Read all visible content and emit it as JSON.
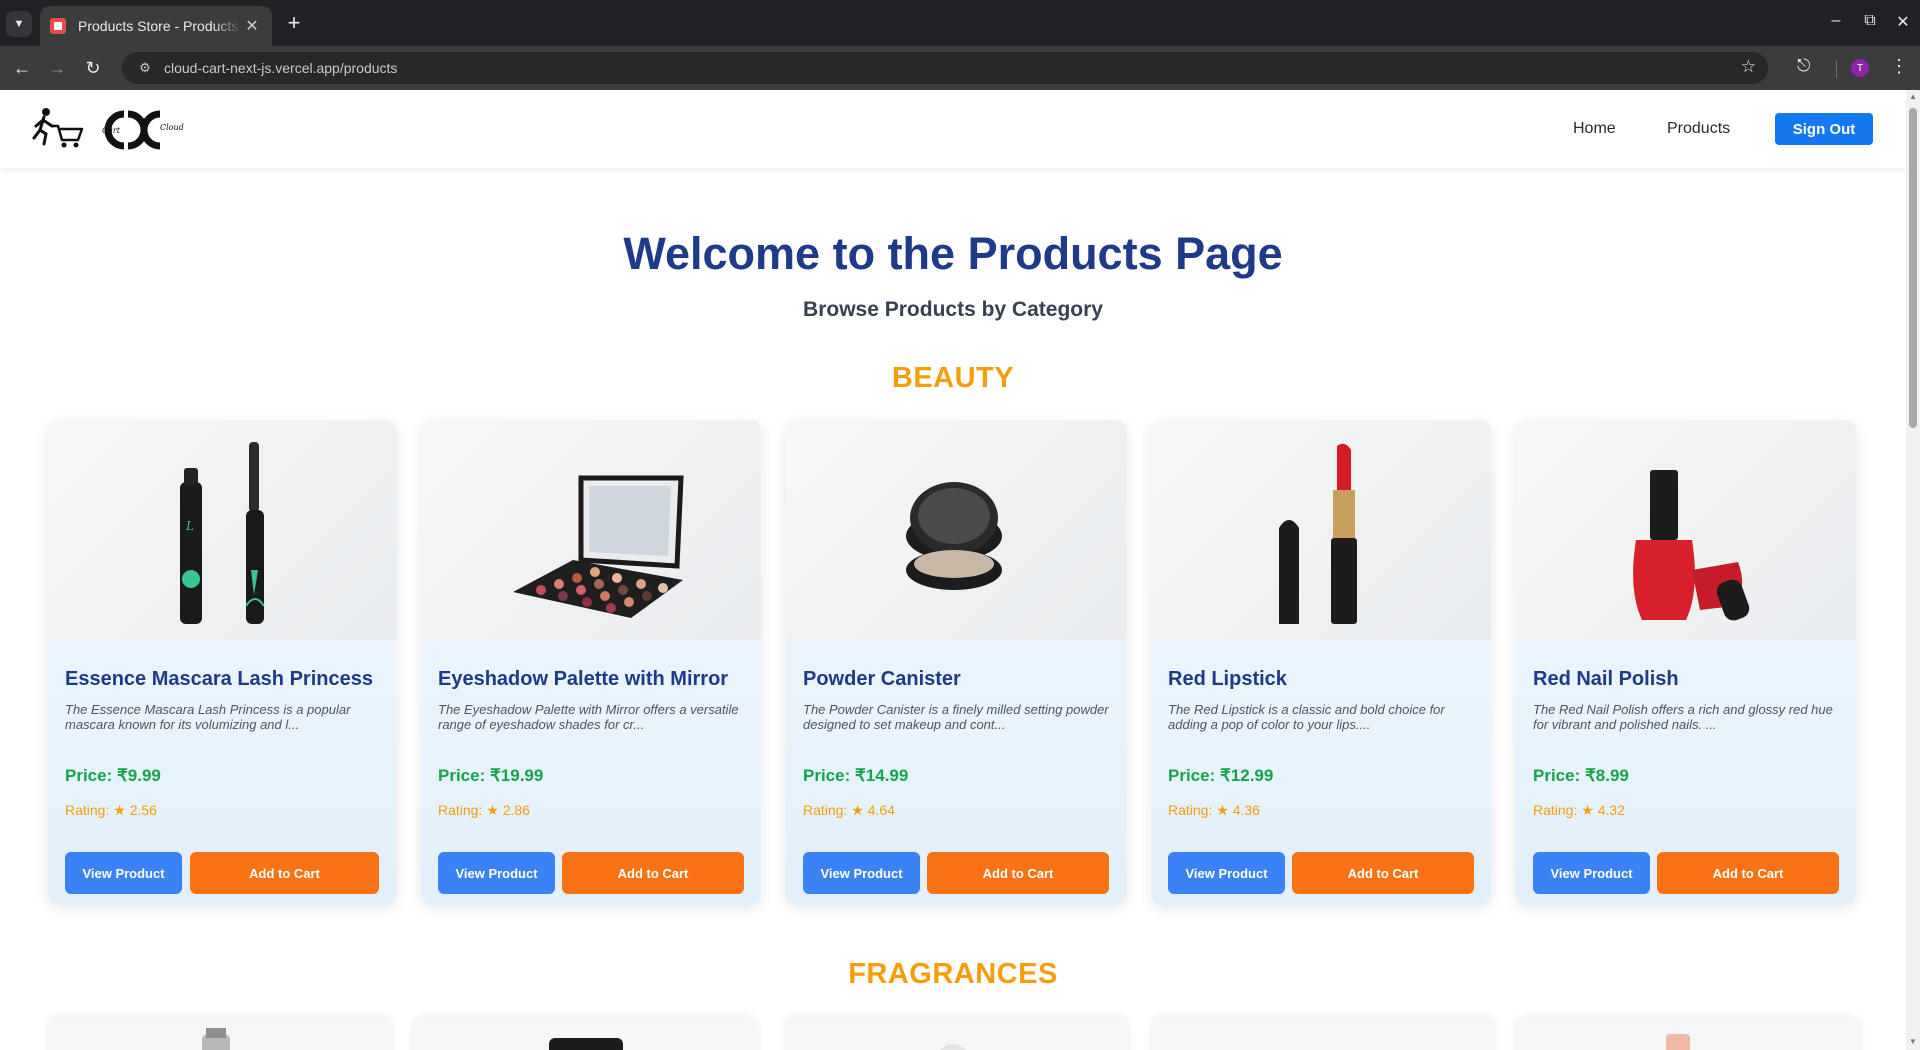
{
  "browser": {
    "tab_title": "Products Store - Products",
    "url": "cloud-cart-next-js.vercel.app/products",
    "profile_initial": "T"
  },
  "site": {
    "logo_text_left": "Cart",
    "logo_text_right": "Cloud",
    "nav": {
      "home": "Home",
      "products": "Products",
      "sign_out": "Sign Out"
    }
  },
  "hero": {
    "title": "Welcome to the Products Page",
    "subtitle": "Browse Products by Category"
  },
  "categories": [
    {
      "name": "BEAUTY",
      "products": [
        {
          "title": "Essence Mascara Lash Princess",
          "description": "The Essence Mascara Lash Princess is a popular mascara known for its volumizing and l...",
          "price": "Price: ₹9.99",
          "rating": "Rating: ★ 2.56",
          "view_label": "View Product",
          "cart_label": "Add to Cart",
          "image_icon": "mascara-icon"
        },
        {
          "title": "Eyeshadow Palette with Mirror",
          "description": "The Eyeshadow Palette with Mirror offers a versatile range of eyeshadow shades for cr...",
          "price": "Price: ₹19.99",
          "rating": "Rating: ★ 2.86",
          "view_label": "View Product",
          "cart_label": "Add to Cart",
          "image_icon": "eyeshadow-palette-icon"
        },
        {
          "title": "Powder Canister",
          "description": "The Powder Canister is a finely milled setting powder designed to set makeup and cont...",
          "price": "Price: ₹14.99",
          "rating": "Rating: ★ 4.64",
          "view_label": "View Product",
          "cart_label": "Add to Cart",
          "image_icon": "powder-canister-icon"
        },
        {
          "title": "Red Lipstick",
          "description": "The Red Lipstick is a classic and bold choice for adding a pop of color to your lips....",
          "price": "Price: ₹12.99",
          "rating": "Rating: ★ 4.36",
          "view_label": "View Product",
          "cart_label": "Add to Cart",
          "image_icon": "lipstick-icon"
        },
        {
          "title": "Red Nail Polish",
          "description": "The Red Nail Polish offers a rich and glossy red hue for vibrant and polished nails. ...",
          "price": "Price: ₹8.99",
          "rating": "Rating: ★ 4.32",
          "view_label": "View Product",
          "cart_label": "Add to Cart",
          "image_icon": "nail-polish-icon"
        }
      ]
    },
    {
      "name": "FRAGRANCES"
    }
  ],
  "colors": {
    "brand_blue": "#1e3a8a",
    "category": "#f59e0b",
    "price": "#16a34a",
    "view_button": "#3b82f6",
    "cart_button": "#f97316",
    "sign_out": "#1478f0"
  }
}
